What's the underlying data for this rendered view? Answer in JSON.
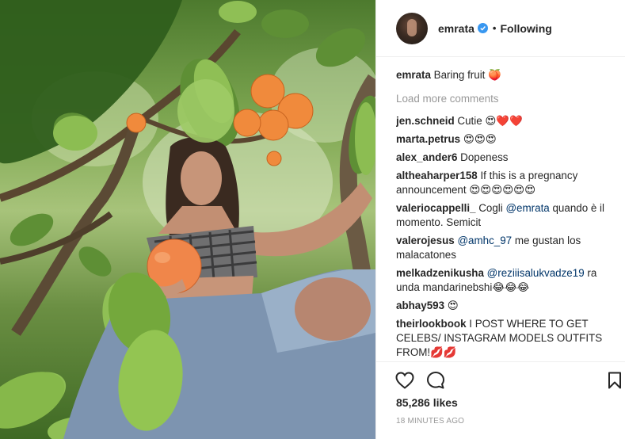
{
  "post": {
    "author": "emrata",
    "follow_status": "Following",
    "separator": "•",
    "caption": {
      "user": "emrata",
      "text": "Baring fruit 🍑"
    },
    "load_more": "Load more comments",
    "comments": [
      {
        "user": "jen.schneid",
        "text": "Cutie 😍❤️❤️"
      },
      {
        "user": "marta.petrus",
        "text": "😍😍😍"
      },
      {
        "user": "alex_ander6",
        "text": "Dopeness"
      },
      {
        "user": "altheaharper158",
        "text": "If this is a pregnancy announcement 😍😍😍😍😍😍"
      },
      {
        "user": "valeriocappelli_",
        "pre": "Cogli ",
        "mention": "@emrata",
        "text": "quando è il momento. Semicit"
      },
      {
        "user": "valerojesus",
        "mention": "@amhc_97",
        "text": "me gustan los malacatones"
      },
      {
        "user": "melkadzenikusha",
        "mention": "@reziiisalukvadze19",
        "text": "ra unda mandarinebshi😂😂😂"
      },
      {
        "user": "abhay593",
        "text": "😍"
      },
      {
        "user": "theirlookbook",
        "text": "I POST WHERE TO GET CELEBS/ INSTAGRAM MODELS OUTFITS FROM!💋💋"
      }
    ],
    "likes": "85,286 likes",
    "time_ago": "18 MINUTES AGO",
    "icons": {
      "like": "heart-outline-icon",
      "comment": "speech-bubble-icon",
      "save": "bookmark-icon",
      "verified": "verified-badge-icon"
    },
    "colors": {
      "verified": "#3897f0",
      "mention": "#003569",
      "muted": "#999999",
      "text": "#262626"
    }
  }
}
